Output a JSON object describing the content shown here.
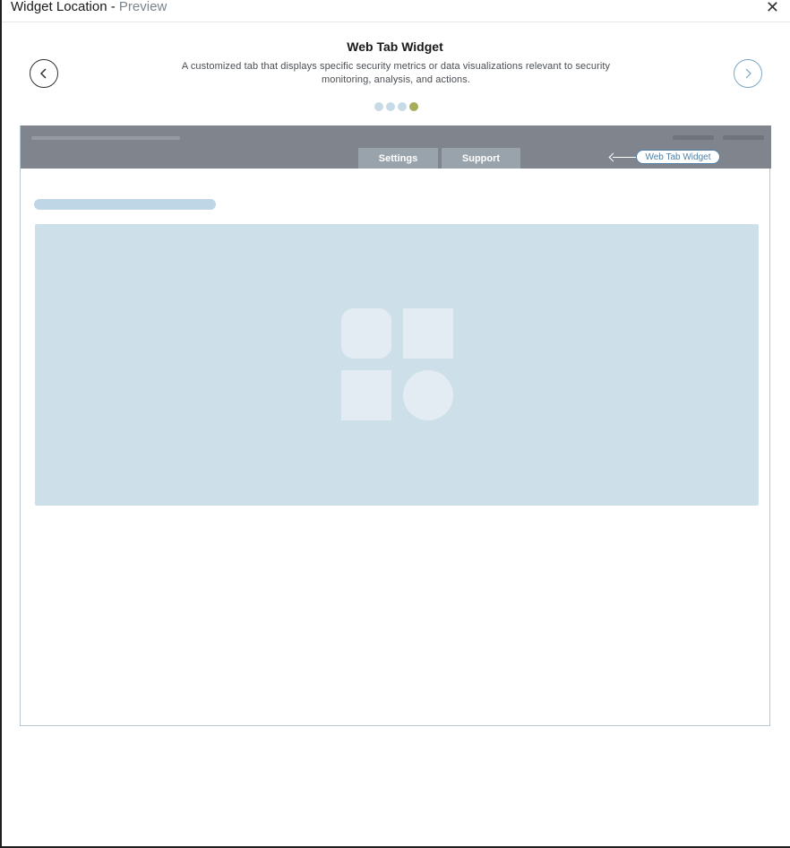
{
  "header": {
    "title": "Widget Location",
    "separator": " - ",
    "subtitle": "Preview",
    "close_icon": "close-icon"
  },
  "carousel": {
    "title": "Web Tab Widget",
    "description": "A customized tab that displays specific security metrics or data visualizations relevant to security monitoring, analysis, and actions.",
    "prev_icon": "chevron-left-icon",
    "next_icon": "chevron-right-icon",
    "total_slides": 4,
    "active_slide": 4
  },
  "preview": {
    "tabs": [
      {
        "label": "Settings"
      },
      {
        "label": "Support"
      }
    ],
    "callout_label": "Web Tab Widget",
    "placeholder_icon": "widget-grid-icon"
  },
  "colors": {
    "topbar": "#80858d",
    "tab_bg": "#99a3ac",
    "accent": "#4f7fa5",
    "active_dot": "#a7ad5a",
    "inactive_dot": "#c7dbe7",
    "panel": "#cde0ea"
  }
}
